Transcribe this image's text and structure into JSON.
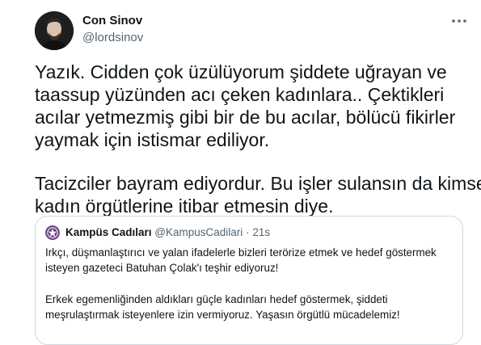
{
  "author": {
    "name": "Con Sinov",
    "handle": "@lordsinov"
  },
  "tweet": {
    "lines": [
      "Yazık. Cidden çok üzülüyorum şiddete uğrayan ve",
      "taassup yüzünden acı çeken kadınlara.. Çektikleri",
      "acılar yetmezmiş gibi bir de bu acılar, bölücü fikirler",
      "yaymak için istismar ediliyor.",
      "Tacizciler bayram ediyordur. Bu işler sulansın da kimse",
      "kadın örgütlerine itibar etmesin diye."
    ]
  },
  "quoted_tweet": {
    "name": "Kampüs Cadıları",
    "handle": "@KampusCadilari",
    "separator": "·",
    "time": "21s",
    "lines": [
      "Irkçı, düşmanlaştırıcı ve yalan ifadelerle bizleri terörize etmek ve hedef göstermek",
      "isteyen gazeteci Batuhan Çolak'ı teşhir ediyoruz!",
      "Erkek egemenliğinden aldıkları güçle kadınları hedef göstermek, şiddeti",
      "meşrulaştırmak isteyenlere izin vermiyoruz. Yaşasın örgütlü mücadelemiz!"
    ]
  },
  "colors": {
    "text": "#0f1419",
    "secondary": "#536471",
    "border": "#cfd9de",
    "quote_avatar": "#6a3f86"
  },
  "icons": {
    "more": "more-horizontal-icon"
  }
}
